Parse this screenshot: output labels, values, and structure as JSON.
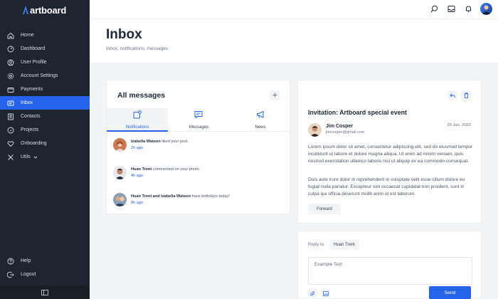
{
  "app": {
    "logo_text": "artboard"
  },
  "sidebar": {
    "items": [
      {
        "label": "Home",
        "icon": "home-icon"
      },
      {
        "label": "Dashboard",
        "icon": "dashboard-icon"
      },
      {
        "label": "User Profile",
        "icon": "user-icon"
      },
      {
        "label": "Account Settings",
        "icon": "gear-icon"
      },
      {
        "label": "Payments",
        "icon": "wallet-icon"
      },
      {
        "label": "Inbox",
        "icon": "inbox-icon",
        "active": true
      },
      {
        "label": "Contacts",
        "icon": "contacts-icon"
      },
      {
        "label": "Projects",
        "icon": "rocket-icon"
      },
      {
        "label": "Onboarding",
        "icon": "heart-icon"
      },
      {
        "label": "Utils",
        "icon": "tools-icon"
      }
    ],
    "bottom_items": [
      {
        "label": "Help",
        "icon": "help-icon"
      },
      {
        "label": "Logout",
        "icon": "logout-icon"
      }
    ]
  },
  "page": {
    "title": "Inbox",
    "subtitle": "Inbox, notifications, messages"
  },
  "messages_card": {
    "title": "All messages",
    "tabs": [
      {
        "label": "Notifications",
        "active": true
      },
      {
        "label": "Messages"
      },
      {
        "label": "News"
      }
    ],
    "notifications": [
      {
        "name": "Izabella Watson",
        "text": " liked your post.",
        "time": "2h ago"
      },
      {
        "name": "Huan Trent",
        "text": " commented on your photo.",
        "time": "4h ago"
      },
      {
        "name": "Huan Trent and Izabella Watson",
        "text": " have birthdays today!",
        "time": "8h ago"
      }
    ]
  },
  "detail": {
    "title": "Invitation: Artboard special event",
    "sender_name": "Jim Cosper",
    "sender_email": "jimcosper@gmail.com",
    "date": "25 Jan, 2020",
    "paragraph1": "Lorem ipsum dolor sit amet, consectetur adipiscing elit, sed do eiusmod tempor incididunt ut labore et dolore magna aliqua. Ut enim ad minim veniam, quis nostrud exercitation ullamco laboris nisi ut aliquip ex ea commodo consequat.",
    "paragraph2": "Duis aute irure dolor in reprehenderit in voluptate velit esse cillum dolore eu fugiat nulla pariatur. Excepteur sint occaecat cupidatat non proident, sunt in culpa qui officia deserunt mollit anim id est laborum.",
    "forward_label": "Forward"
  },
  "reply": {
    "label": "Reply to:",
    "recipient": "Huan Trent",
    "placeholder": "Example Text",
    "send_label": "Send"
  },
  "colors": {
    "accent": "#2563eb",
    "sidebar_bg": "#1f2530"
  }
}
